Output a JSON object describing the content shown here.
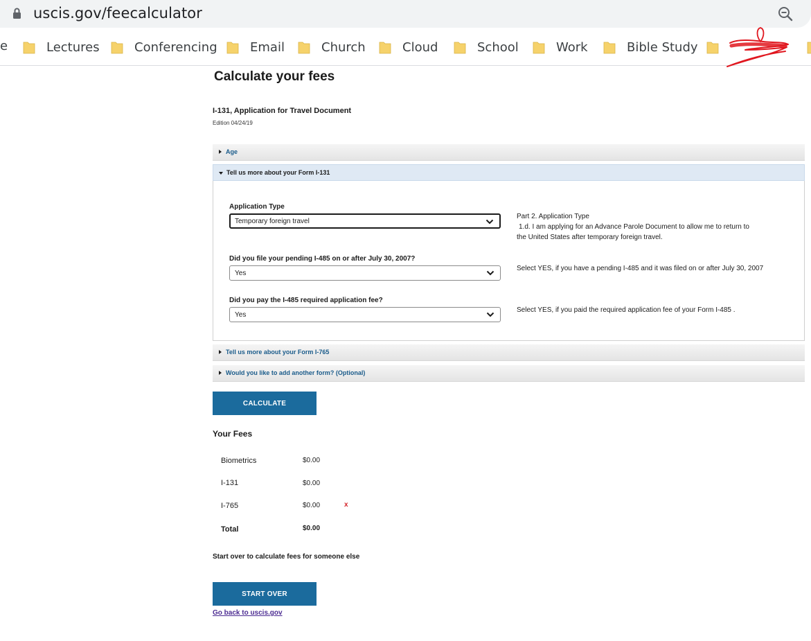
{
  "browser": {
    "url": "uscis.gov/feecalculator",
    "icons": {
      "lock": "lock-icon",
      "zoom": "zoom-out-icon"
    },
    "bookmark_cut_label": "e",
    "bookmarks": [
      {
        "label": "Lectures"
      },
      {
        "label": "Conferencing"
      },
      {
        "label": "Email"
      },
      {
        "label": "Church"
      },
      {
        "label": "Cloud"
      },
      {
        "label": "School"
      },
      {
        "label": "Work"
      },
      {
        "label": "Bible Study"
      },
      {
        "label": ""
      }
    ],
    "folder_color": "#f6d26b"
  },
  "page": {
    "title": "Calculate your fees",
    "form_title": "I-131, Application for Travel Document",
    "edition": "Edition 04/24/19"
  },
  "accordions": {
    "age": {
      "label": "Age",
      "expanded": false
    },
    "i131": {
      "label": "Tell us more about your Form I-131",
      "expanded": true
    },
    "i765": {
      "label": "Tell us more about your Form I-765",
      "expanded": false
    },
    "another": {
      "label": "Would you like to add another form? (Optional)",
      "expanded": false
    }
  },
  "questions": {
    "application_type": {
      "label": "Application Type",
      "value": "Temporary foreign travel",
      "hint_title": "Part 2. Application Type",
      "hint_body": "1.d. I am applying for an Advance Parole Document to allow me to return to",
      "hint_body2": "the United States after temporary foreign travel."
    },
    "pending_i485": {
      "label": "Did you file your pending I-485 on or after July 30, 2007?",
      "value": "Yes",
      "hint": "Select YES, if you have a pending I-485 and it was filed on or after July 30, 2007"
    },
    "paid_i485": {
      "label": "Did you pay the I-485 required application fee?",
      "value": "Yes",
      "hint": "Select YES, if you paid the required application fee of your Form I-485 ."
    }
  },
  "actions": {
    "calculate_label": "CALCULATE",
    "start_over_label": "START OVER",
    "back_link": "Go back to uscis.gov"
  },
  "fees": {
    "title": "Your Fees",
    "rows": [
      {
        "name": "Biometrics",
        "amount": "$0.00",
        "remove": ""
      },
      {
        "name": "I-131",
        "amount": "$0.00",
        "remove": ""
      },
      {
        "name": "I-765",
        "amount": "$0.00",
        "remove": "x"
      }
    ],
    "total_label": "Total",
    "total_amount": "$0.00"
  },
  "start_over_text": "Start over to calculate fees for someone else",
  "colors": {
    "primary_button": "#1b6b9d",
    "link": "#1a5b8a",
    "remove": "#d4242a",
    "visited_link": "#4c2c92"
  }
}
